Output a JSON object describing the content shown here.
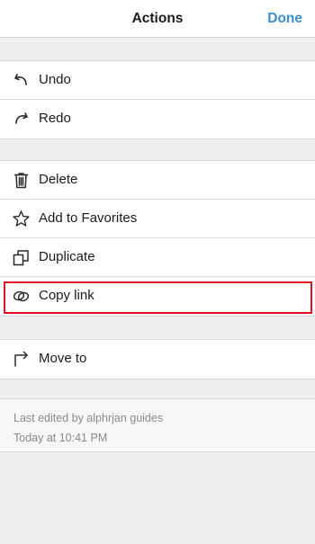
{
  "header": {
    "title": "Actions",
    "done_label": "Done"
  },
  "history_group": {
    "items": [
      {
        "label": "Undo",
        "icon": "undo-icon"
      },
      {
        "label": "Redo",
        "icon": "redo-icon"
      }
    ]
  },
  "edit_group": {
    "items": [
      {
        "label": "Delete",
        "icon": "trash-icon"
      },
      {
        "label": "Add to Favorites",
        "icon": "star-icon"
      },
      {
        "label": "Duplicate",
        "icon": "duplicate-icon"
      },
      {
        "label": "Copy link",
        "icon": "link-icon",
        "highlighted": true
      }
    ]
  },
  "move_group": {
    "items": [
      {
        "label": "Move to",
        "icon": "move-arrow-icon"
      }
    ]
  },
  "footer": {
    "last_edited": "Last edited by alphrjan guides",
    "timestamp": "Today at 10:41 PM"
  },
  "colors": {
    "accent": "#3b8fcf",
    "highlight": "#e0141e",
    "background": "#efefef"
  }
}
